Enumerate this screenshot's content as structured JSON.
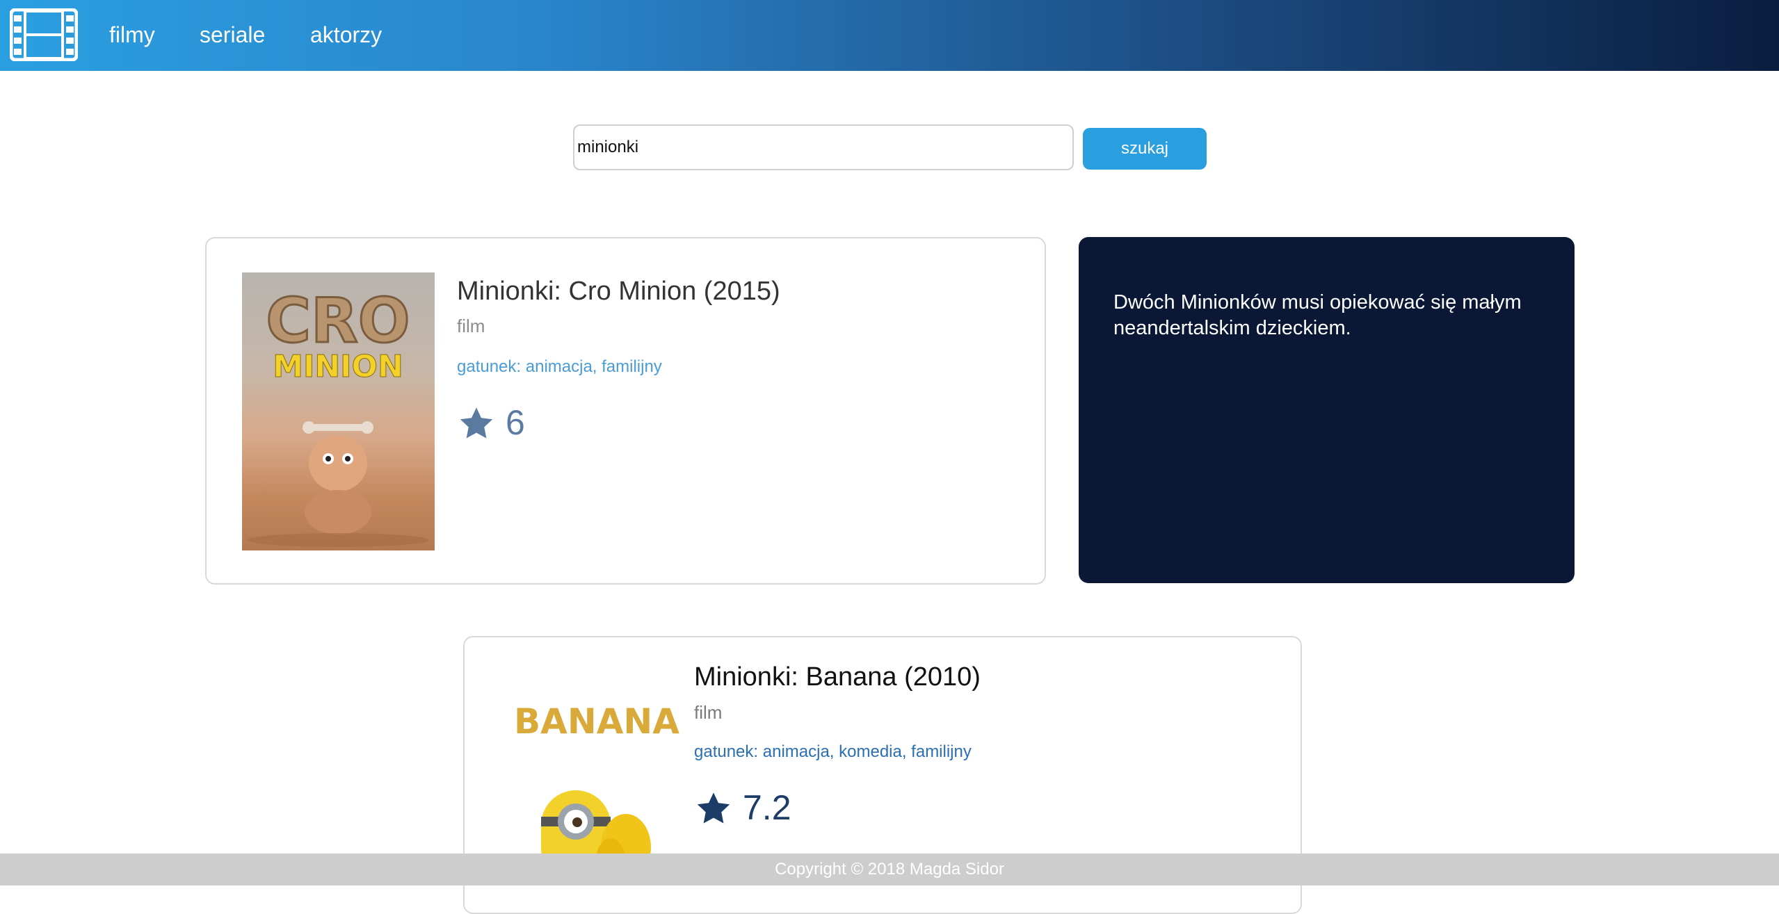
{
  "nav": {
    "logo_icon": "film-strip-icon",
    "items": [
      {
        "label": "filmy"
      },
      {
        "label": "seriale"
      },
      {
        "label": "aktorzy"
      }
    ]
  },
  "search": {
    "value": "minionki",
    "button_label": "szukaj"
  },
  "results": [
    {
      "title": "Minionki: Cro Minion (2015)",
      "type": "film",
      "genre": "gatunek: animacja, familijny",
      "rating": "6",
      "poster_text_1": "CRO",
      "poster_text_2": "MINION",
      "description": "Dwóch Minionków musi opiekować się małym neandertalskim dzieckiem."
    },
    {
      "title": "Minionki: Banana (2010)",
      "type": "film",
      "genre": "gatunek: animacja, komedia, familijny",
      "rating": "7.2",
      "poster_text": "BANANA"
    }
  ],
  "footer": {
    "text": "Copyright © 2018 Magda Sidor"
  },
  "colors": {
    "accent": "#2a9fdf",
    "nav_dark": "#0a1d3f",
    "description_panel": "#0a1836",
    "genre_link": "#4a9cd6",
    "star_first": "#5b7aa0",
    "star_second": "#1c3d67"
  }
}
